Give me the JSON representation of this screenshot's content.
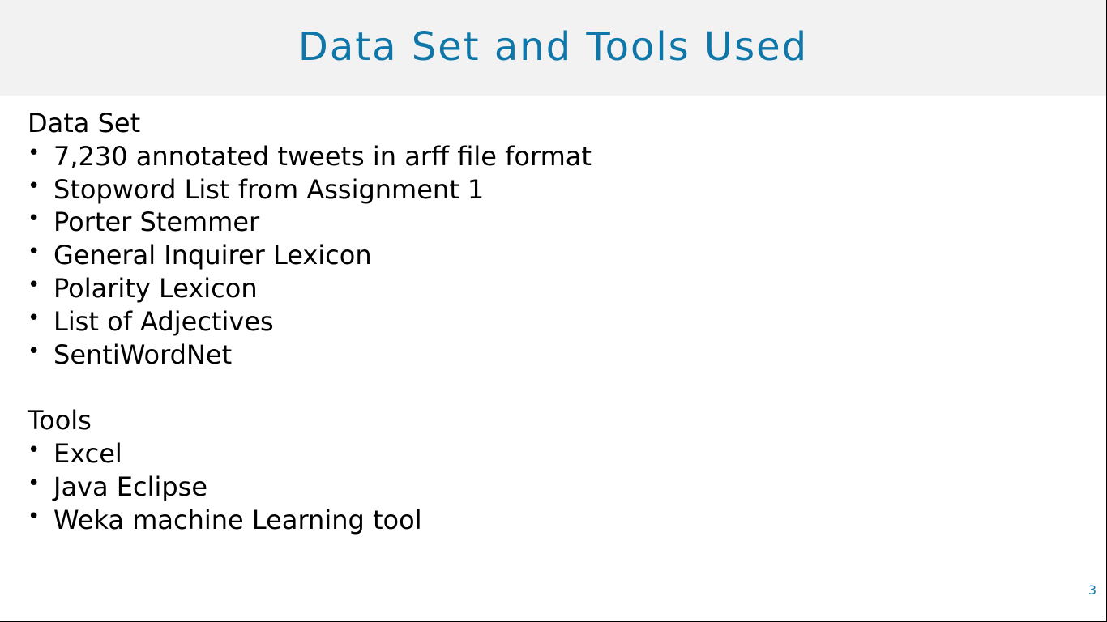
{
  "slide": {
    "title": "Data Set and Tools Used",
    "page_number": "3",
    "colors": {
      "title": "#0e76a8",
      "title_band": "#f2f2f2",
      "text": "#000000"
    },
    "bullet_glyph": "•",
    "sections": [
      {
        "heading": "Data Set",
        "items": [
          "7,230 annotated tweets in arff file format",
          "Stopword List from Assignment 1",
          "Porter Stemmer",
          "General Inquirer Lexicon",
          "Polarity Lexicon",
          "List of Adjectives",
          "SentiWordNet"
        ]
      },
      {
        "heading": "Tools",
        "items": [
          "Excel",
          "Java Eclipse",
          "Weka machine Learning tool"
        ]
      }
    ]
  }
}
